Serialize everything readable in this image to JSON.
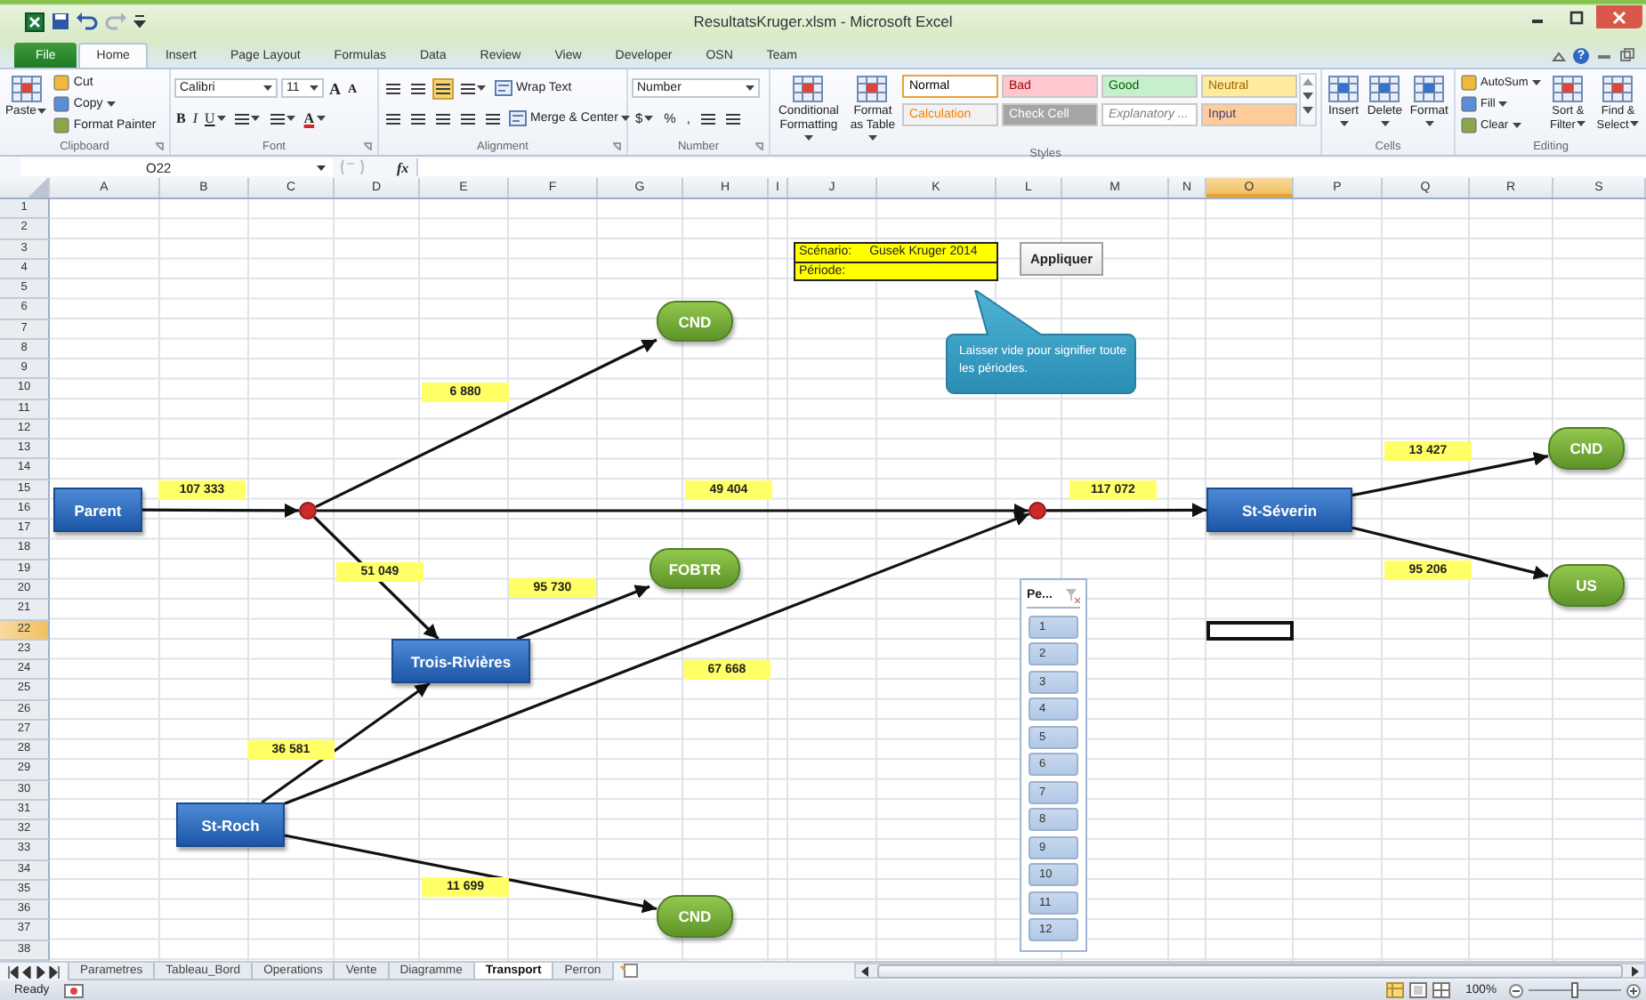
{
  "window": {
    "title": "ResultatsKruger.xlsm - Microsoft Excel",
    "help": "?"
  },
  "ribbon_tabs": [
    {
      "label": "File",
      "kind": "file",
      "selected": false
    },
    {
      "label": "Home",
      "kind": "tab",
      "selected": true
    },
    {
      "label": "Insert",
      "kind": "tab",
      "selected": false
    },
    {
      "label": "Page Layout",
      "kind": "tab",
      "selected": false
    },
    {
      "label": "Formulas",
      "kind": "tab",
      "selected": false
    },
    {
      "label": "Data",
      "kind": "tab",
      "selected": false
    },
    {
      "label": "Review",
      "kind": "tab",
      "selected": false
    },
    {
      "label": "View",
      "kind": "tab",
      "selected": false
    },
    {
      "label": "Developer",
      "kind": "tab",
      "selected": false
    },
    {
      "label": "OSN",
      "kind": "tab",
      "selected": false
    },
    {
      "label": "Team",
      "kind": "tab",
      "selected": false
    }
  ],
  "ribbon_groups": [
    {
      "label": "Clipboard",
      "parts": [
        {
          "kind": "big",
          "label": "Paste",
          "dropdown": true
        },
        {
          "kind": "col",
          "items": [
            {
              "label": "Cut",
              "dropdown": false
            },
            {
              "label": "Copy",
              "dropdown": true
            },
            {
              "label": "Format Painter",
              "dropdown": false
            }
          ]
        }
      ]
    },
    {
      "label": "Font",
      "parts": [
        {
          "kind": "lines",
          "lines": [
            {
              "items": [
                {
                  "kind": "select",
                  "label": "Calibri"
                },
                {
                  "kind": "select",
                  "label": "11"
                },
                {
                  "kind": "text",
                  "label": "A"
                },
                {
                  "kind": "text",
                  "label": "A"
                }
              ]
            },
            {
              "items": [
                {
                  "kind": "text",
                  "label": "B"
                },
                {
                  "kind": "text",
                  "label": "I"
                },
                {
                  "kind": "text",
                  "label": "U",
                  "dropdown": true
                },
                {
                  "kind": "icon",
                  "dropdown": true
                },
                {
                  "kind": "icon",
                  "dropdown": true
                },
                {
                  "kind": "text",
                  "label": "A",
                  "dropdown": true
                }
              ]
            }
          ]
        }
      ]
    },
    {
      "label": "Alignment",
      "parts": [
        {
          "kind": "lines",
          "lines": [
            {
              "items": [
                {
                  "kind": "icon",
                  "selected": false
                },
                {
                  "kind": "icon",
                  "selected": false
                },
                {
                  "kind": "icon",
                  "selected": true
                },
                {
                  "kind": "icon",
                  "selected": false,
                  "dropdown": true
                },
                {
                  "kind": "small",
                  "label": "Wrap Text"
                }
              ]
            },
            {
              "items": [
                {
                  "kind": "icon",
                  "selected": false
                },
                {
                  "kind": "icon",
                  "selected": false
                },
                {
                  "kind": "icon",
                  "selected": false
                },
                {
                  "kind": "icon",
                  "selected": false
                },
                {
                  "kind": "icon",
                  "selected": false
                },
                {
                  "kind": "small",
                  "label": "Merge & Center",
                  "dropdown": true
                }
              ]
            }
          ]
        }
      ]
    },
    {
      "label": "Number",
      "parts": [
        {
          "kind": "lines",
          "lines": [
            {
              "items": [
                {
                  "kind": "select",
                  "label": "Number"
                }
              ]
            },
            {
              "items": [
                {
                  "kind": "text",
                  "label": "$",
                  "dropdown": true
                },
                {
                  "kind": "text",
                  "label": "%"
                },
                {
                  "kind": "text",
                  "label": ","
                },
                {
                  "kind": "icon"
                },
                {
                  "kind": "icon"
                }
              ]
            }
          ]
        }
      ]
    },
    {
      "label": "Styles",
      "parts": [
        {
          "kind": "big",
          "label": "Conditional Formatting",
          "dropdown": true
        },
        {
          "kind": "big",
          "label": "Format as Table",
          "dropdown": true
        },
        {
          "kind": "styles",
          "styles": [
            {
              "label": "Normal",
              "color": "#ffffff",
              "selected": true
            },
            {
              "label": "Bad",
              "color": "#ffc7ce",
              "selected": false
            },
            {
              "label": "Good",
              "color": "#c6efce",
              "selected": false
            },
            {
              "label": "Neutral",
              "color": "#ffeb9c",
              "selected": false
            },
            {
              "label": "Calculation",
              "color": "#f2f2f2",
              "selected": false
            },
            {
              "label": "Check Cell",
              "color": "#a5a5a5",
              "selected": false
            },
            {
              "label": "Explanatory ...",
              "color": "#ffffff",
              "selected": false
            },
            {
              "label": "Input",
              "color": "#ffcc99",
              "selected": false
            }
          ]
        }
      ]
    },
    {
      "label": "Cells",
      "parts": [
        {
          "kind": "big",
          "label": "Insert",
          "dropdown": true
        },
        {
          "kind": "big",
          "label": "Delete",
          "dropdown": true
        },
        {
          "kind": "big",
          "label": "Format",
          "dropdown": true
        }
      ]
    },
    {
      "label": "Editing",
      "parts": [
        {
          "kind": "col",
          "items": [
            {
              "label": "AutoSum",
              "dropdown": true
            },
            {
              "label": "Fill",
              "dropdown": true
            },
            {
              "label": "Clear",
              "dropdown": true
            }
          ]
        },
        {
          "kind": "big",
          "label": "Sort & Filter",
          "dropdown": true
        },
        {
          "kind": "big",
          "label": "Find & Select",
          "dropdown": true
        }
      ]
    }
  ],
  "formula_bar": {
    "name_box": "O22",
    "fx": "fx"
  },
  "sheet": {
    "columns": [
      {
        "label": "A",
        "selected": false
      },
      {
        "label": "B",
        "selected": false
      },
      {
        "label": "C",
        "selected": false
      },
      {
        "label": "D",
        "selected": false
      },
      {
        "label": "E",
        "selected": false
      },
      {
        "label": "F",
        "selected": false
      },
      {
        "label": "G",
        "selected": false
      },
      {
        "label": "H",
        "selected": false
      },
      {
        "label": "I",
        "selected": false
      },
      {
        "label": "J",
        "selected": false
      },
      {
        "label": "K",
        "selected": false
      },
      {
        "label": "L",
        "selected": false
      },
      {
        "label": "M",
        "selected": false
      },
      {
        "label": "N",
        "selected": false
      },
      {
        "label": "O",
        "selected": true
      },
      {
        "label": "P",
        "selected": false
      },
      {
        "label": "Q",
        "selected": false
      },
      {
        "label": "R",
        "selected": false
      },
      {
        "label": "S",
        "selected": false
      }
    ],
    "rows": [
      {
        "label": "1",
        "selected": false
      },
      {
        "label": "2",
        "selected": false
      },
      {
        "label": "3",
        "selected": false
      },
      {
        "label": "4",
        "selected": false
      },
      {
        "label": "5",
        "selected": false
      },
      {
        "label": "6",
        "selected": false
      },
      {
        "label": "7",
        "selected": false
      },
      {
        "label": "8",
        "selected": false
      },
      {
        "label": "9",
        "selected": false
      },
      {
        "label": "10",
        "selected": false
      },
      {
        "label": "11",
        "selected": false
      },
      {
        "label": "12",
        "selected": false
      },
      {
        "label": "13",
        "selected": false
      },
      {
        "label": "14",
        "selected": false
      },
      {
        "label": "15",
        "selected": false
      },
      {
        "label": "16",
        "selected": false
      },
      {
        "label": "17",
        "selected": false
      },
      {
        "label": "18",
        "selected": false
      },
      {
        "label": "19",
        "selected": false
      },
      {
        "label": "20",
        "selected": false
      },
      {
        "label": "21",
        "selected": false
      },
      {
        "label": "22",
        "selected": true
      },
      {
        "label": "23",
        "selected": false
      },
      {
        "label": "24",
        "selected": false
      },
      {
        "label": "25",
        "selected": false
      },
      {
        "label": "26",
        "selected": false
      },
      {
        "label": "27",
        "selected": false
      },
      {
        "label": "28",
        "selected": false
      },
      {
        "label": "29",
        "selected": false
      },
      {
        "label": "30",
        "selected": false
      },
      {
        "label": "31",
        "selected": false
      },
      {
        "label": "32",
        "selected": false
      },
      {
        "label": "33",
        "selected": false
      },
      {
        "label": "34",
        "selected": false
      },
      {
        "label": "35",
        "selected": false
      },
      {
        "label": "36",
        "selected": false
      },
      {
        "label": "37",
        "selected": false
      },
      {
        "label": "38",
        "selected": false
      }
    ]
  },
  "filter": {
    "scenario_label": "Scénario:",
    "scenario": "Gusek Kruger 2014",
    "period_label": "Période:"
  },
  "apply_button": "Appliquer",
  "callout": "Laisser vide pour  signifier toute les périodes.",
  "diagram": {
    "nodes": [
      {
        "kind": "box",
        "label": "Parent"
      },
      {
        "kind": "dot"
      },
      {
        "kind": "pill",
        "label": "CND"
      },
      {
        "kind": "box",
        "label": "Trois-Rivières"
      },
      {
        "kind": "pill",
        "label": "FOBTR"
      },
      {
        "kind": "box",
        "label": "St-Roch"
      },
      {
        "kind": "pill",
        "label": "CND"
      },
      {
        "kind": "dot"
      },
      {
        "kind": "box",
        "label": "St-Séverin"
      },
      {
        "kind": "pill",
        "label": "CND"
      },
      {
        "kind": "pill",
        "label": "US"
      }
    ],
    "flows": [
      {
        "amount": "107 333"
      },
      {
        "amount": "6 880"
      },
      {
        "amount": "49 404"
      },
      {
        "amount": "51 049"
      },
      {
        "amount": "95 730"
      },
      {
        "amount": "36 581"
      },
      {
        "amount": "67 668"
      },
      {
        "amount": "11 699"
      },
      {
        "amount": "117 072"
      },
      {
        "amount": "13 427"
      },
      {
        "amount": "95 206"
      }
    ]
  },
  "slicer": {
    "title": "Pe...",
    "items": [
      {
        "label": "1",
        "selected": true
      },
      {
        "label": "2",
        "selected": true
      },
      {
        "label": "3",
        "selected": true
      },
      {
        "label": "4",
        "selected": true
      },
      {
        "label": "5",
        "selected": true
      },
      {
        "label": "6",
        "selected": true
      },
      {
        "label": "7",
        "selected": true
      },
      {
        "label": "8",
        "selected": true
      },
      {
        "label": "9",
        "selected": true
      },
      {
        "label": "10",
        "selected": true
      },
      {
        "label": "11",
        "selected": true
      },
      {
        "label": "12",
        "selected": true
      }
    ]
  },
  "sheet_tabs": [
    {
      "label": "Parametres",
      "selected": false
    },
    {
      "label": "Tableau_Bord",
      "selected": false
    },
    {
      "label": "Operations",
      "selected": false
    },
    {
      "label": "Vente",
      "selected": false
    },
    {
      "label": "Diagramme",
      "selected": false
    },
    {
      "label": "Transport",
      "selected": true
    },
    {
      "label": "Perron",
      "selected": false
    }
  ],
  "status": {
    "text": "Ready",
    "zoom": {
      "reading": "100%",
      "level": 0.5
    }
  }
}
